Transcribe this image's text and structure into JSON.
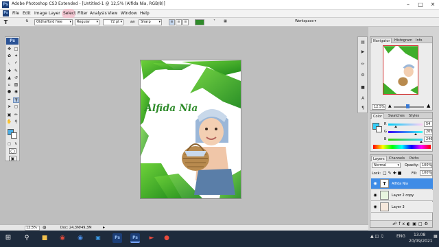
{
  "window": {
    "app_icon": "Ps",
    "title": "Adobe Photoshop CS3 Extended - [Untitled-1 @ 12,5% (Alfida Nia, RGB/8)]",
    "minimize_icon": "minimize-icon",
    "maximize_icon": "maximize-icon",
    "close_icon": "close-icon"
  },
  "menu": {
    "app_icon": "Ps",
    "items": [
      "File",
      "Edit",
      "Image",
      "Layer",
      "Select",
      "Filter",
      "Analysis",
      "View",
      "Window",
      "Help"
    ],
    "highlighted": "Select"
  },
  "options": {
    "tool_icon": "T",
    "font_family": "Oldhafford free",
    "font_style": "Regular",
    "font_size": "72 pt",
    "antialias_prefix": "aa",
    "antialias": "Sharp",
    "align_left": "align-left-icon",
    "align_center": "align-center-icon",
    "align_right": "align-right-icon",
    "text_color": "#2f8a2a",
    "workspace_label": "Workspace"
  },
  "toolbox": {
    "badge": "Ps",
    "foreground_color": "#4aaee6",
    "background_color": "#ffffff",
    "active_tool": "type-tool"
  },
  "document": {
    "canvas_text": "Alfida Nia",
    "text_color": "#2e8b2a"
  },
  "status": {
    "zoom": "12,5%",
    "doc_size": "Doc: 24,3M/49,3M"
  },
  "navigator": {
    "tabs": [
      "Navigator",
      "Histogram",
      "Info"
    ],
    "zoom": "12,5%"
  },
  "color_panel": {
    "tabs": [
      "Color",
      "Swatches",
      "Styles"
    ],
    "channels": [
      {
        "label": "R",
        "value": "54",
        "level": 0.21
      },
      {
        "label": "G",
        "value": "205",
        "level": 0.8
      },
      {
        "label": "B",
        "value": "246",
        "level": 0.96
      }
    ],
    "swatch": "#36cdf6"
  },
  "layers_panel": {
    "tabs": [
      "Layers",
      "Channels",
      "Paths"
    ],
    "blend_mode": "Normal",
    "opacity_label": "Opacity:",
    "opacity": "100%",
    "lock_label": "Lock:",
    "fill_label": "Fill:",
    "fill": "100%",
    "layers": [
      {
        "name": "Alfida Nia",
        "thumb": "T",
        "active": true
      },
      {
        "name": "Layer 2 copy",
        "thumb": "",
        "active": false
      },
      {
        "name": "Layer 3",
        "thumb": "",
        "active": false
      }
    ]
  },
  "taskbar": {
    "clock_time": "13.08",
    "clock_date": "20/09/2021",
    "lang": "ENG"
  }
}
